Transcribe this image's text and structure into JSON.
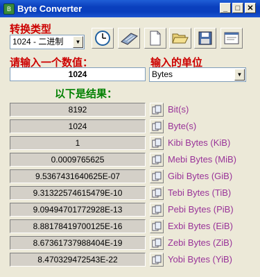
{
  "window": {
    "title": "Byte Converter"
  },
  "labels": {
    "conversion_type": "转换类型",
    "input_value": "请输入一个数值：",
    "input_unit": "输入的单位",
    "results": "以下是结果："
  },
  "conversion_type": {
    "selected": "1024 - 二进制"
  },
  "input": {
    "value": "1024"
  },
  "unit_select": {
    "selected": "Bytes"
  },
  "results": [
    {
      "value": "8192",
      "unit": "Bit(s)"
    },
    {
      "value": "1024",
      "unit": "Byte(s)"
    },
    {
      "value": "1",
      "unit": "Kibi Bytes (KiB)"
    },
    {
      "value": "0.0009765625",
      "unit": "Mebi Bytes (MiB)"
    },
    {
      "value": "9.5367431640625E-07",
      "unit": "Gibi Bytes (GiB)"
    },
    {
      "value": "9.31322574615479E-10",
      "unit": "Tebi Bytes (TiB)"
    },
    {
      "value": "9.09494701772928E-13",
      "unit": "Pebi Bytes (PiB)"
    },
    {
      "value": "8.88178419700125E-16",
      "unit": "Exbi Bytes (EiB)"
    },
    {
      "value": "8.67361737988404E-19",
      "unit": "Zebi Bytes (ZiB)"
    },
    {
      "value": "8.470329472543E-22",
      "unit": "Yobi Bytes (YiB)"
    }
  ],
  "icons": {
    "app": "app-icon",
    "toolbar": [
      "clock-icon",
      "calculator-icon",
      "new-document-icon",
      "open-folder-icon",
      "save-disk-icon",
      "about-window-icon"
    ],
    "copy": "copy-icon"
  },
  "colors": {
    "titlebar": "#0a3fbd",
    "label_red": "#cc0000",
    "label_green": "#008000",
    "unit_purple": "#993399"
  }
}
